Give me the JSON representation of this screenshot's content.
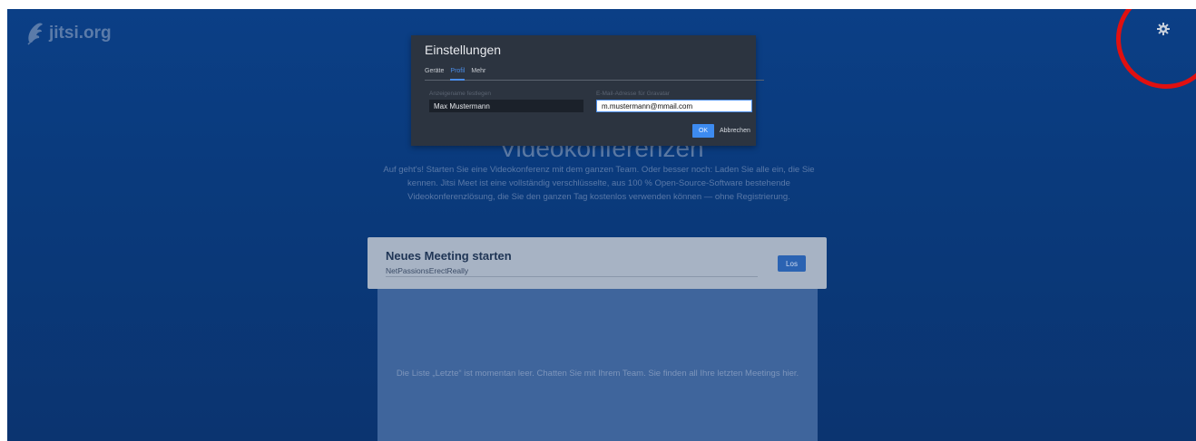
{
  "app": {
    "logo_text": "jitsi.org"
  },
  "hero": {
    "title": "Videokonferenzen",
    "text": "Auf geht's! Starten Sie eine Videokonferenz mit dem ganzen Team. Oder besser noch: Laden Sie alle ein, die Sie kennen. Jitsi Meet ist eine vollständig verschlüsselte, aus 100 % Open-Source-Software bestehende Videokonferenzlösung, die Sie den ganzen Tag kostenlos verwenden können — ohne Registrierung."
  },
  "start_meeting": {
    "title": "Neues Meeting starten",
    "room_value": "NetPassionsErectReally",
    "go_label": "Los"
  },
  "recent": {
    "empty_text": "Die Liste „Letzte“ ist momentan leer. Chatten Sie mit Ihrem Team. Sie finden all Ihre letzten Meetings hier."
  },
  "settings_dialog": {
    "title": "Einstellungen",
    "tabs": [
      {
        "label": "Geräte",
        "active": false
      },
      {
        "label": "Profil",
        "active": true
      },
      {
        "label": "Mehr",
        "active": false
      }
    ],
    "display_name_label": "Anzeigename festlegen",
    "display_name_value": "Max Mustermann",
    "email_label": "E-Mail-Adresse für Gravatar",
    "email_value": "m.mustermann@mmail.com",
    "ok_label": "OK",
    "cancel_label": "Abbrechen"
  },
  "colors": {
    "background": "#0b3f86",
    "accent": "#3d8bf0",
    "highlight_circle": "#e01010"
  },
  "icons": [
    "jitsi-logo-icon",
    "settings-gear-icon"
  ]
}
